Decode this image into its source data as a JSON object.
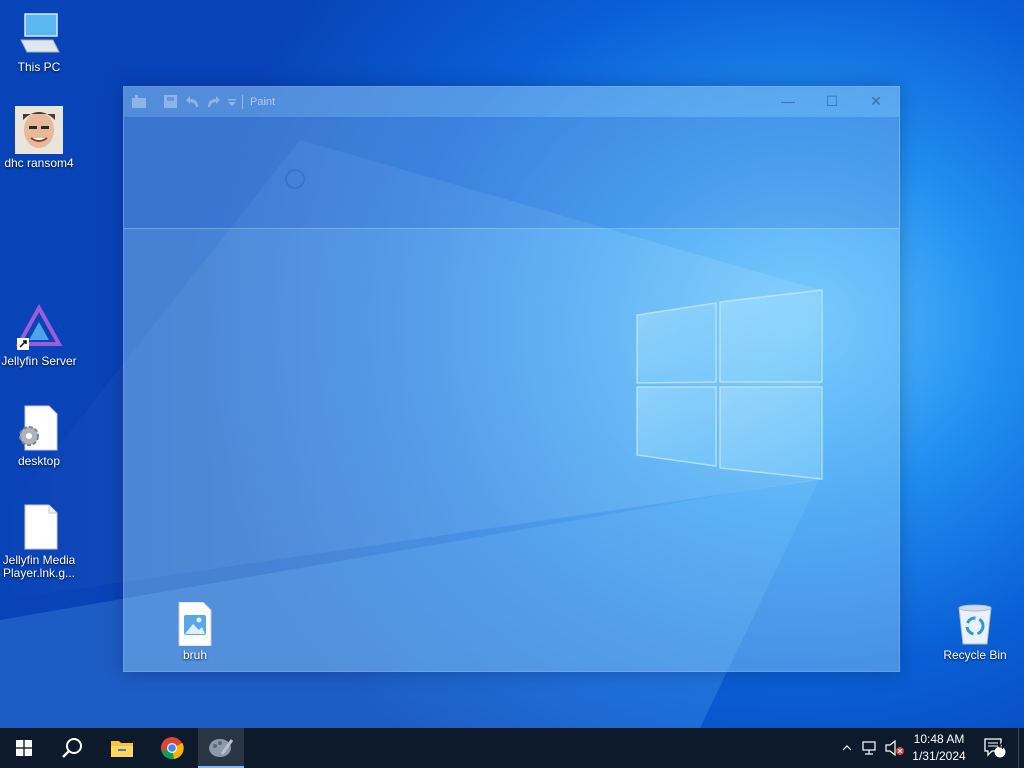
{
  "desktop": {
    "icons": [
      {
        "label": "This PC",
        "icon": "computer-icon"
      },
      {
        "label": "dhc ransom4",
        "icon": "photo-icon"
      },
      {
        "label": "Jellyfin Server",
        "icon": "jellyfin-icon"
      },
      {
        "label": "desktop",
        "icon": "settings-file-icon"
      },
      {
        "label": "Jellyfin Media Player.lnk.g...",
        "icon": "blank-file-icon"
      },
      {
        "label": "bruh",
        "icon": "image-file-icon"
      },
      {
        "label": "Recycle Bin",
        "icon": "recycle-bin-icon"
      }
    ]
  },
  "paint_window": {
    "title": "Paint",
    "controls": {
      "minimize": "—",
      "maximize": "☐",
      "close": "✕"
    }
  },
  "taskbar": {
    "apps": [
      {
        "name": "start",
        "icon": "windows-logo-icon"
      },
      {
        "name": "search",
        "icon": "search-icon"
      },
      {
        "name": "file-explorer",
        "icon": "folder-icon"
      },
      {
        "name": "chrome",
        "icon": "chrome-icon"
      },
      {
        "name": "paint",
        "icon": "paint-icon"
      }
    ],
    "tray": {
      "chevron": "^",
      "time": "10:48 AM",
      "date": "1/31/2024",
      "notifications": "4"
    }
  },
  "colors": {
    "taskbar": "#0d1a2b",
    "accent": "#7fb6ff"
  }
}
